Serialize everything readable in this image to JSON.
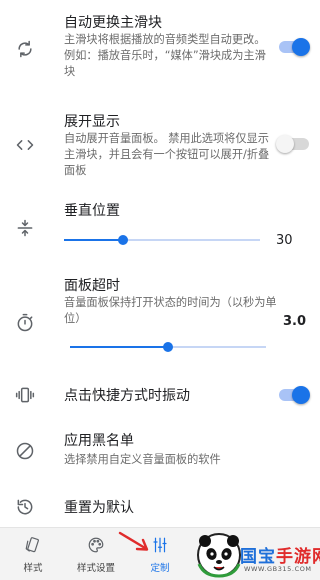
{
  "settings": {
    "auto_switch": {
      "title": "自动更换主滑块",
      "desc": "主滑块将根据播放的音频类型自动更改。例如：播放音乐时，“媒体”滑块成为主滑块",
      "enabled": true,
      "icon": "sync-icon"
    },
    "expand": {
      "title": "展开显示",
      "desc": "自动展开音量面板。 禁用此选项将仅显示主滑块，并且会有一个按钮可以展开/折叠面板",
      "enabled": false,
      "icon": "expand-code-icon"
    },
    "vertical": {
      "title": "垂直位置",
      "value": "30",
      "level": 0.3,
      "icon": "vertical-position-icon"
    },
    "timeout": {
      "title": "面板超时",
      "desc": "音量面板保持打开状态的时间为（以秒为单位）",
      "value": "3.0",
      "level": 0.5,
      "icon": "timer-icon"
    },
    "vibrate": {
      "title": "点击快捷方式时振动",
      "enabled": true,
      "icon": "vibrate-icon"
    },
    "blacklist": {
      "title": "应用黑名单",
      "desc": "选择禁用自定义音量面板的软件",
      "icon": "block-icon"
    },
    "reset": {
      "title": "重置为默认",
      "icon": "restore-icon"
    }
  },
  "tabs": [
    {
      "label": "样式",
      "icon": "style-icon",
      "active": false
    },
    {
      "label": "样式设置",
      "icon": "palette-icon",
      "active": false
    },
    {
      "label": "定制",
      "icon": "tune-icon",
      "active": true
    }
  ],
  "watermark": {
    "title_a": "国宝",
    "title_b": "手游网",
    "url": "WWW.GB315.COM"
  },
  "colors": {
    "accent": "#1a73e8",
    "arrow": "#e02b2b"
  }
}
